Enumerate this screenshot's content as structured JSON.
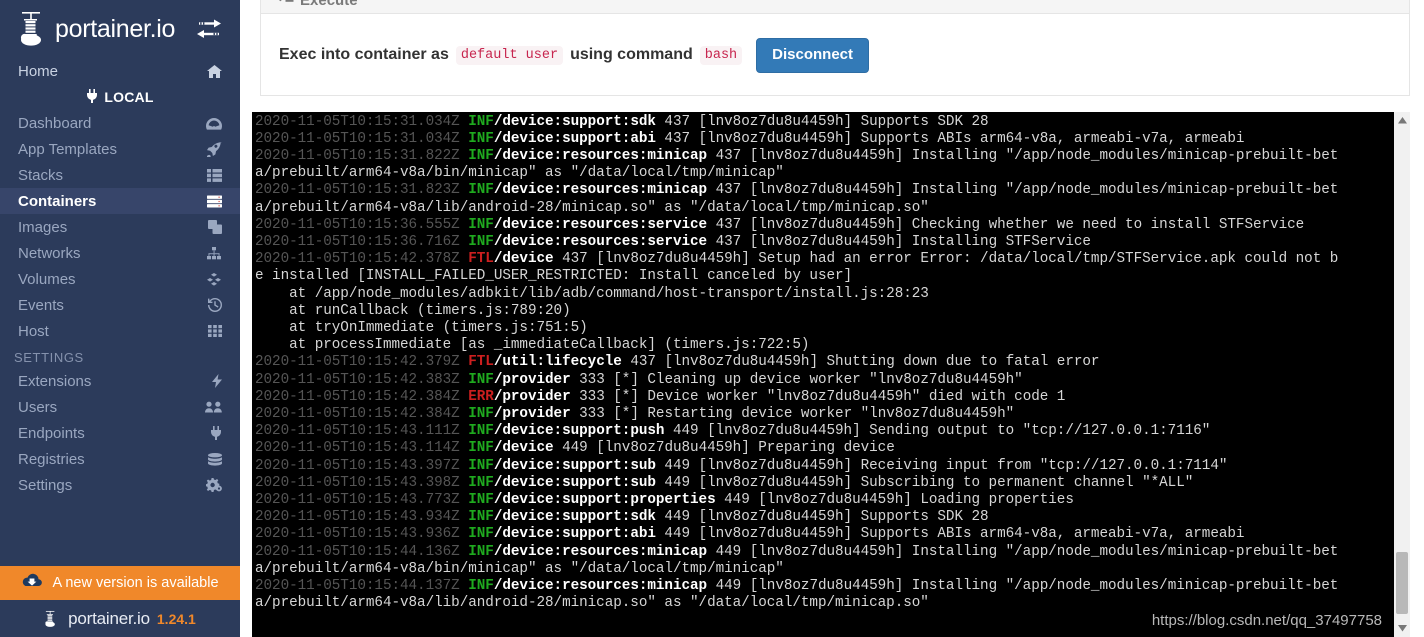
{
  "sidebar": {
    "brand": "portainer.io",
    "toggle_icon": "exchange-arrows-icon",
    "home": {
      "label": "Home",
      "icon": "home-icon"
    },
    "local_section": {
      "label": "LOCAL",
      "icon": "plug-icon"
    },
    "items": [
      {
        "label": "Dashboard",
        "icon": "dashboard-icon",
        "active": false
      },
      {
        "label": "App Templates",
        "icon": "rocket-icon",
        "active": false
      },
      {
        "label": "Stacks",
        "icon": "list-icon",
        "active": false
      },
      {
        "label": "Containers",
        "icon": "server-icon",
        "active": true
      },
      {
        "label": "Images",
        "icon": "clone-icon",
        "active": false
      },
      {
        "label": "Networks",
        "icon": "sitemap-icon",
        "active": false
      },
      {
        "label": "Volumes",
        "icon": "cubes-icon",
        "active": false
      },
      {
        "label": "Events",
        "icon": "history-icon",
        "active": false
      },
      {
        "label": "Host",
        "icon": "th-icon",
        "active": false
      }
    ],
    "settings_header": "SETTINGS",
    "settings_items": [
      {
        "label": "Extensions",
        "icon": "bolt-icon"
      },
      {
        "label": "Users",
        "icon": "users-icon"
      },
      {
        "label": "Endpoints",
        "icon": "plug-icon"
      },
      {
        "label": "Registries",
        "icon": "database-icon"
      },
      {
        "label": "Settings",
        "icon": "gears-icon"
      }
    ],
    "update_banner": {
      "label": "A new version is available",
      "icon": "cloud-download-icon",
      "color": "#f0882a"
    },
    "footer": {
      "brand": "portainer.io",
      "version": "1.24.1"
    }
  },
  "panel": {
    "title": "Execute",
    "title_icon": "terminal-icon",
    "exec_prefix": "Exec into container as",
    "user": "default user",
    "exec_middle": "using command",
    "command": "bash",
    "disconnect_label": "Disconnect",
    "disconnect_color": "#337ab7"
  },
  "terminal": {
    "background": "#000000",
    "level_colors": {
      "INF": "#1faa1f",
      "FTL": "#cc1f1f",
      "ERR": "#cc1f1f"
    },
    "lines": [
      {
        "time": "2020-11-05T10:15:31.034Z",
        "level": "INF",
        "tag": "/device:support:sdk",
        "msg": " 437 [lnv8oz7du8u4459h] Supports SDK 28"
      },
      {
        "time": "2020-11-05T10:15:31.034Z",
        "level": "INF",
        "tag": "/device:support:abi",
        "msg": " 437 [lnv8oz7du8u4459h] Supports ABIs arm64-v8a, armeabi-v7a, armeabi"
      },
      {
        "time": "2020-11-05T10:15:31.822Z",
        "level": "INF",
        "tag": "/device:resources:minicap",
        "msg": " 437 [lnv8oz7du8u4459h] Installing \"/app/node_modules/minicap-prebuilt-bet"
      },
      {
        "time": "",
        "level": "",
        "tag": "",
        "msg": "a/prebuilt/arm64-v8a/bin/minicap\" as \"/data/local/tmp/minicap\""
      },
      {
        "time": "2020-11-05T10:15:31.823Z",
        "level": "INF",
        "tag": "/device:resources:minicap",
        "msg": " 437 [lnv8oz7du8u4459h] Installing \"/app/node_modules/minicap-prebuilt-bet"
      },
      {
        "time": "",
        "level": "",
        "tag": "",
        "msg": "a/prebuilt/arm64-v8a/lib/android-28/minicap.so\" as \"/data/local/tmp/minicap.so\""
      },
      {
        "time": "2020-11-05T10:15:36.555Z",
        "level": "INF",
        "tag": "/device:resources:service",
        "msg": " 437 [lnv8oz7du8u4459h] Checking whether we need to install STFService"
      },
      {
        "time": "2020-11-05T10:15:36.716Z",
        "level": "INF",
        "tag": "/device:resources:service",
        "msg": " 437 [lnv8oz7du8u4459h] Installing STFService"
      },
      {
        "time": "2020-11-05T10:15:42.378Z",
        "level": "FTL",
        "tag": "/device",
        "msg": " 437 [lnv8oz7du8u4459h] Setup had an error Error: /data/local/tmp/STFService.apk could not b"
      },
      {
        "time": "",
        "level": "",
        "tag": "",
        "msg": "e installed [INSTALL_FAILED_USER_RESTRICTED: Install canceled by user]"
      },
      {
        "time": "",
        "level": "",
        "tag": "",
        "msg": "    at /app/node_modules/adbkit/lib/adb/command/host-transport/install.js:28:23"
      },
      {
        "time": "",
        "level": "",
        "tag": "",
        "msg": "    at runCallback (timers.js:789:20)"
      },
      {
        "time": "",
        "level": "",
        "tag": "",
        "msg": "    at tryOnImmediate (timers.js:751:5)"
      },
      {
        "time": "",
        "level": "",
        "tag": "",
        "msg": "    at processImmediate [as _immediateCallback] (timers.js:722:5)"
      },
      {
        "time": "2020-11-05T10:15:42.379Z",
        "level": "FTL",
        "tag": "/util:lifecycle",
        "msg": " 437 [lnv8oz7du8u4459h] Shutting down due to fatal error"
      },
      {
        "time": "2020-11-05T10:15:42.383Z",
        "level": "INF",
        "tag": "/provider",
        "msg": " 333 [*] Cleaning up device worker \"lnv8oz7du8u4459h\""
      },
      {
        "time": "2020-11-05T10:15:42.384Z",
        "level": "ERR",
        "tag": "/provider",
        "msg": " 333 [*] Device worker \"lnv8oz7du8u4459h\" died with code 1"
      },
      {
        "time": "2020-11-05T10:15:42.384Z",
        "level": "INF",
        "tag": "/provider",
        "msg": " 333 [*] Restarting device worker \"lnv8oz7du8u4459h\""
      },
      {
        "time": "2020-11-05T10:15:43.111Z",
        "level": "INF",
        "tag": "/device:support:push",
        "msg": " 449 [lnv8oz7du8u4459h] Sending output to \"tcp://127.0.0.1:7116\""
      },
      {
        "time": "2020-11-05T10:15:43.114Z",
        "level": "INF",
        "tag": "/device",
        "msg": " 449 [lnv8oz7du8u4459h] Preparing device"
      },
      {
        "time": "2020-11-05T10:15:43.397Z",
        "level": "INF",
        "tag": "/device:support:sub",
        "msg": " 449 [lnv8oz7du8u4459h] Receiving input from \"tcp://127.0.0.1:7114\""
      },
      {
        "time": "2020-11-05T10:15:43.398Z",
        "level": "INF",
        "tag": "/device:support:sub",
        "msg": " 449 [lnv8oz7du8u4459h] Subscribing to permanent channel \"*ALL\""
      },
      {
        "time": "2020-11-05T10:15:43.773Z",
        "level": "INF",
        "tag": "/device:support:properties",
        "msg": " 449 [lnv8oz7du8u4459h] Loading properties"
      },
      {
        "time": "2020-11-05T10:15:43.934Z",
        "level": "INF",
        "tag": "/device:support:sdk",
        "msg": " 449 [lnv8oz7du8u4459h] Supports SDK 28"
      },
      {
        "time": "2020-11-05T10:15:43.936Z",
        "level": "INF",
        "tag": "/device:support:abi",
        "msg": " 449 [lnv8oz7du8u4459h] Supports ABIs arm64-v8a, armeabi-v7a, armeabi"
      },
      {
        "time": "2020-11-05T10:15:44.136Z",
        "level": "INF",
        "tag": "/device:resources:minicap",
        "msg": " 449 [lnv8oz7du8u4459h] Installing \"/app/node_modules/minicap-prebuilt-bet"
      },
      {
        "time": "",
        "level": "",
        "tag": "",
        "msg": "a/prebuilt/arm64-v8a/bin/minicap\" as \"/data/local/tmp/minicap\""
      },
      {
        "time": "2020-11-05T10:15:44.137Z",
        "level": "INF",
        "tag": "/device:resources:minicap",
        "msg": " 449 [lnv8oz7du8u4459h] Installing \"/app/node_modules/minicap-prebuilt-bet"
      },
      {
        "time": "",
        "level": "",
        "tag": "",
        "msg": "a/prebuilt/arm64-v8a/lib/android-28/minicap.so\" as \"/data/local/tmp/minicap.so\""
      }
    ]
  },
  "watermark": "https://blog.csdn.net/qq_37497758"
}
